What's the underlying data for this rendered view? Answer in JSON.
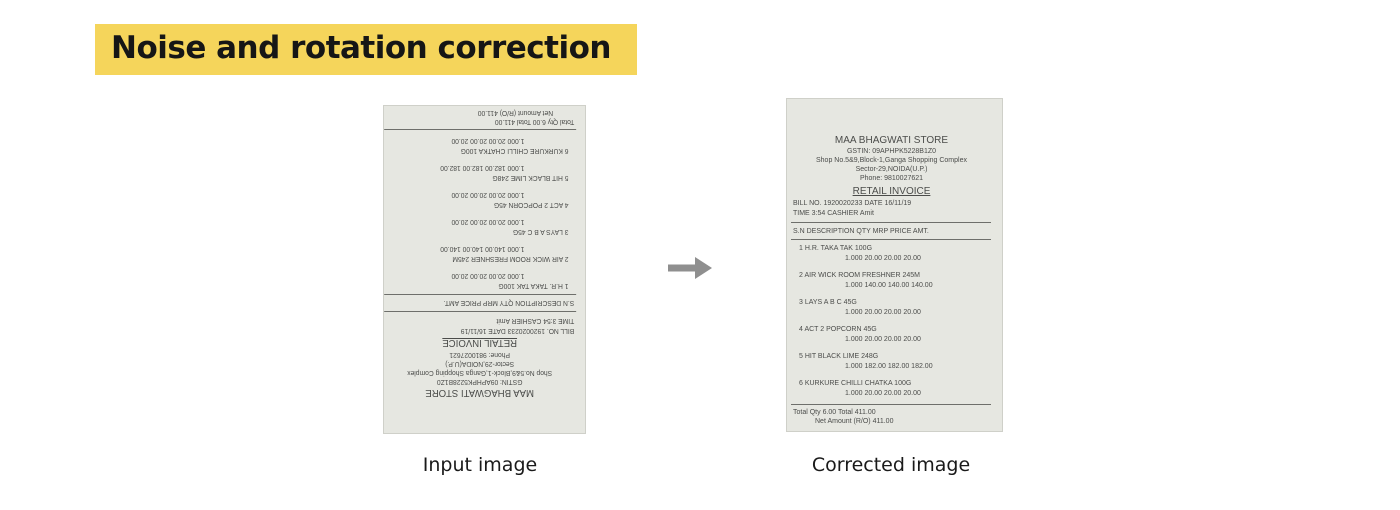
{
  "title": "Noise and rotation correction",
  "captions": {
    "input": "Input image",
    "corrected": "Corrected image"
  },
  "arrow_icon": "arrow-right-icon",
  "accent_color": "#f5d55b",
  "receipt": {
    "store": "MAA BHAGWATI STORE",
    "gstin": "GSTIN: 09APHPK5228B1Z0",
    "address": "Shop No.5&9,Block-1,Ganga Shopping Complex",
    "sector": "Sector-29,NOIDA(U.P.)",
    "phone": "Phone: 9810027621",
    "doc_title": "RETAIL INVOICE",
    "bill_line": "BILL NO.  1920020233     DATE   16/11/19",
    "time_line": "TIME  3:54       CASHIER   Amit",
    "header": "S.N  DESCRIPTION  QTY   MRP  PRICE      AMT.",
    "items": [
      {
        "desc": "1  H.R. TAKA TAK 100G",
        "nums": "1.000     20.00     20.00          20.00"
      },
      {
        "desc": "2  AIR WICK ROOM FRESHNER 245M",
        "nums": "1.000   140.00   140.00        140.00"
      },
      {
        "desc": "3  LAYS A B C 45G",
        "nums": "1.000     20.00     20.00          20.00"
      },
      {
        "desc": "4  ACT 2 POPCORN 45G",
        "nums": "1.000     20.00     20.00          20.00"
      },
      {
        "desc": "5  HIT BLACK LIME 248G",
        "nums": "1.000   182.00   182.00        182.00"
      },
      {
        "desc": "6  KURKURE CHILLI CHATKA 100G",
        "nums": "1.000     20.00     20.00          20.00"
      }
    ],
    "total_line": "Total Qty       6.00        Total             411.00",
    "net_line": "Net Amount (R/O)                           411.00"
  }
}
